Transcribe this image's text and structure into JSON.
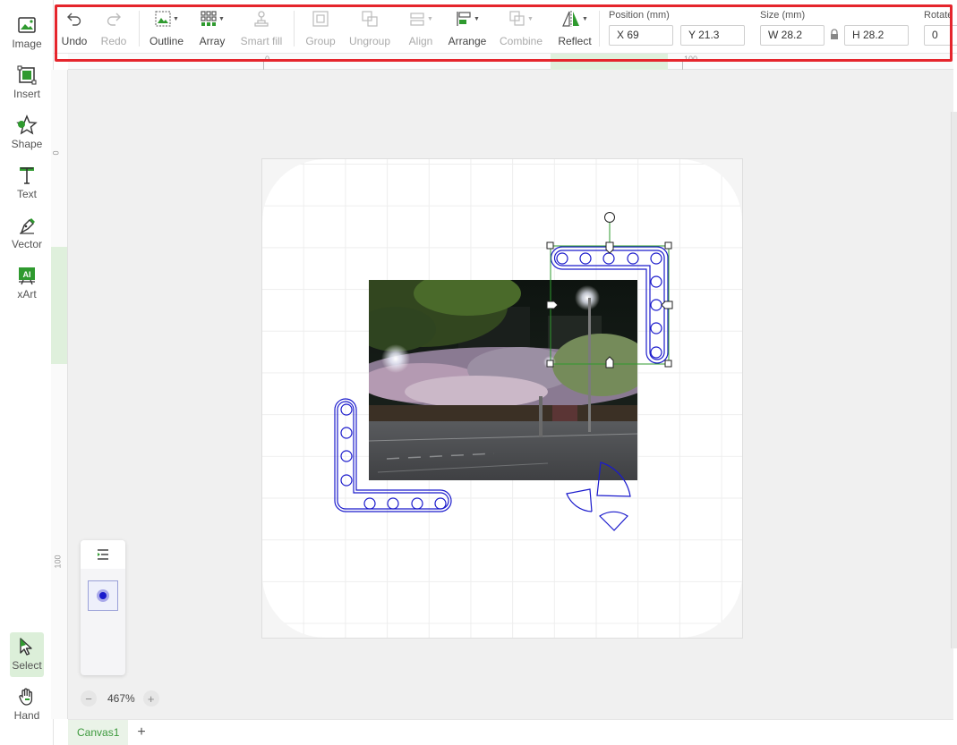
{
  "left_tools": [
    {
      "label": "Image",
      "icon": "image-icon"
    },
    {
      "label": "Insert",
      "icon": "insert-icon"
    },
    {
      "label": "Shape",
      "icon": "shape-star-icon"
    },
    {
      "label": "Text",
      "icon": "text-icon"
    },
    {
      "label": "Vector",
      "icon": "pen-icon"
    },
    {
      "label": "xArt",
      "icon": "ai-icon"
    }
  ],
  "bottom_tools": [
    {
      "label": "Select",
      "icon": "cursor-icon",
      "active": true
    },
    {
      "label": "Hand",
      "icon": "hand-icon"
    }
  ],
  "toolbar": {
    "undo": "Undo",
    "redo": "Redo",
    "outline": "Outline",
    "array": "Array",
    "smart_fill": "Smart fill",
    "group": "Group",
    "ungroup": "Ungroup",
    "align": "Align",
    "arrange": "Arrange",
    "combine": "Combine",
    "reflect": "Reflect",
    "position_label": "Position (mm)",
    "x_value": "X 69",
    "y_value": "Y 21.3",
    "size_label": "Size (mm)",
    "w_value": "W 28.2",
    "h_value": "H 28.2",
    "rotate_label": "Rotate",
    "rotate_value": "0"
  },
  "rulers": {
    "top": [
      "0",
      "100"
    ],
    "left": [
      "0",
      "100"
    ]
  },
  "zoom": {
    "value": "467%",
    "minus": "−",
    "plus": "+"
  },
  "tabs": [
    {
      "label": "Canvas1"
    }
  ],
  "tab_add": "+",
  "colors": {
    "accent": "#3d9a3d",
    "selection": "#2e9a2e",
    "shape_stroke": "#1a1acc",
    "annotation": "#e5252c"
  }
}
